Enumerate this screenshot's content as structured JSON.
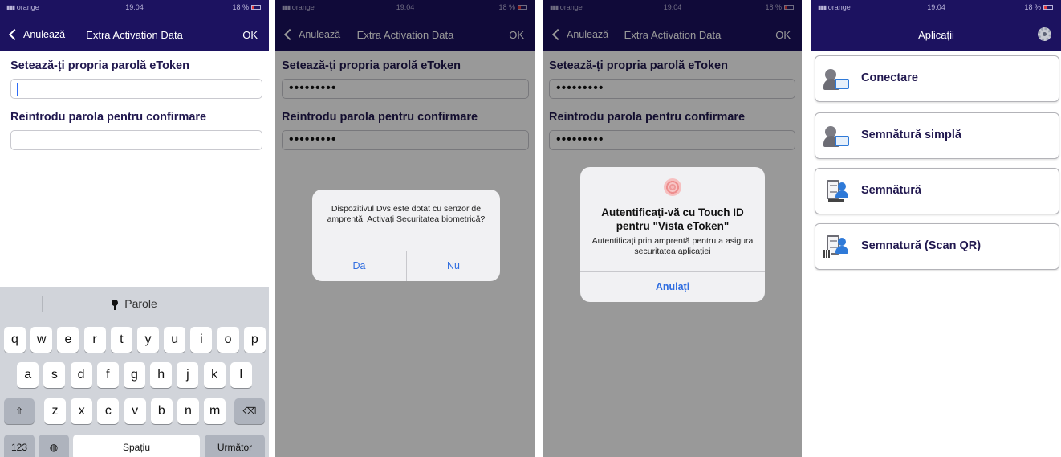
{
  "status_bar": {
    "carrier": "orange",
    "time": "19:04",
    "battery": "18 %"
  },
  "activation_nav": {
    "back_label": "Anulează",
    "title": "Extra Activation Data",
    "ok_label": "OK"
  },
  "form": {
    "password_label": "Setează-ți propria parolă eToken",
    "confirm_label": "Reintrodu parola pentru confirmare",
    "password_masked": "•••••••••",
    "confirm_masked": "•••••••••"
  },
  "keyboard": {
    "suggestion": "Parole",
    "row1": [
      "q",
      "w",
      "e",
      "r",
      "t",
      "y",
      "u",
      "i",
      "o",
      "p"
    ],
    "row2": [
      "a",
      "s",
      "d",
      "f",
      "g",
      "h",
      "j",
      "k",
      "l"
    ],
    "row3": [
      "z",
      "x",
      "c",
      "v",
      "b",
      "n",
      "m"
    ],
    "numbers_key": "123",
    "space_key": "Spațiu",
    "next_key": "Următor"
  },
  "biometric_dialog": {
    "message": "Dispozitivul Dvs este dotat cu senzor de amprentă. Activați Securitatea biometrică?",
    "yes_label": "Da",
    "no_label": "Nu"
  },
  "touchid_dialog": {
    "title": "Autentificați-vă cu Touch ID pentru \"Vista eToken\"",
    "message": "Autentificați prin amprentă pentru a asigura securitatea aplicației",
    "cancel_label": "Anulați"
  },
  "apps_screen": {
    "title": "Aplicații",
    "items": [
      {
        "label": "Conectare",
        "icon": "person-card-icon"
      },
      {
        "label": "Semnătură simplă",
        "icon": "person-card-icon"
      },
      {
        "label": "Semnătură",
        "icon": "document-signature-icon"
      },
      {
        "label": "Semnatură (Scan QR)",
        "icon": "qr-signature-icon"
      }
    ]
  },
  "colors": {
    "navbar": "#1c1260",
    "label_text": "#21184f",
    "dialog_button": "#2f6de0"
  }
}
